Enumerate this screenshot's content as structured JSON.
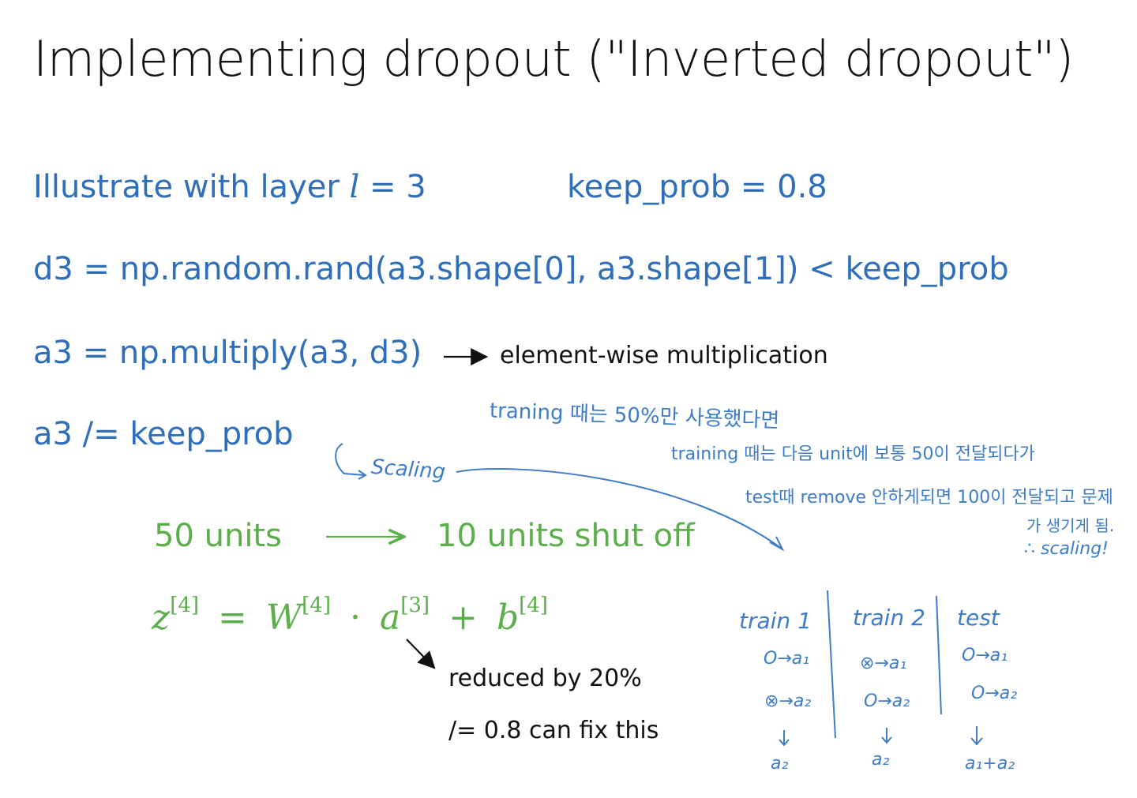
{
  "title": "Implementing dropout (\"Inverted dropout\")",
  "illustrate": {
    "prefix": "Illustrate with layer ",
    "layer_symbol": "l",
    "suffix": " = 3",
    "keep_prob": "keep_prob = 0.8"
  },
  "code": {
    "d3": "d3 = np.random.rand(a3.shape[0], a3.shape[1]) < keep_prob",
    "a3_multiply": "a3 = np.multiply(a3, d3)",
    "a3_divide": "a3 /= keep_prob"
  },
  "notes": {
    "elementwise": "element-wise multiplication",
    "reduced": "reduced by 20%",
    "fix": "/= 0.8 can fix this"
  },
  "units": {
    "left": "50 units",
    "right": "10 units shut off"
  },
  "equation": {
    "z": "z",
    "z_sup": "[4]",
    "eq": "=",
    "W": "W",
    "W_sup": "[4]",
    "dot": "·",
    "a": "a",
    "a_sup": "[3]",
    "plus": "+",
    "b": "b",
    "b_sup": "[4]"
  },
  "handwriting": {
    "scaling": "Scaling",
    "note1": "traning 때는 50%만 사용했다면",
    "note2": "training 때는 다음 unit에 보통 50이 전달되다가",
    "note3": "test때 remove 안하게되면 100이 전달되고 문제",
    "note4": "가 생기게 됨.",
    "note5": "∴ scaling!",
    "columns": [
      {
        "head": "train 1",
        "row1": "O→a₁",
        "row2": "⊗→a₂",
        "result": "a₂"
      },
      {
        "head": "train 2",
        "row1": "⊗→a₁",
        "row2": "O→a₂",
        "result": "a₂"
      },
      {
        "head": "test",
        "row1": "O→a₁",
        "row2": "O→a₂",
        "result": "a₁+a₂"
      }
    ]
  },
  "colors": {
    "blue": "#2F6EBA",
    "green": "#5AAF4A",
    "handwriting": "#3D7CC9",
    "black": "#111111"
  }
}
